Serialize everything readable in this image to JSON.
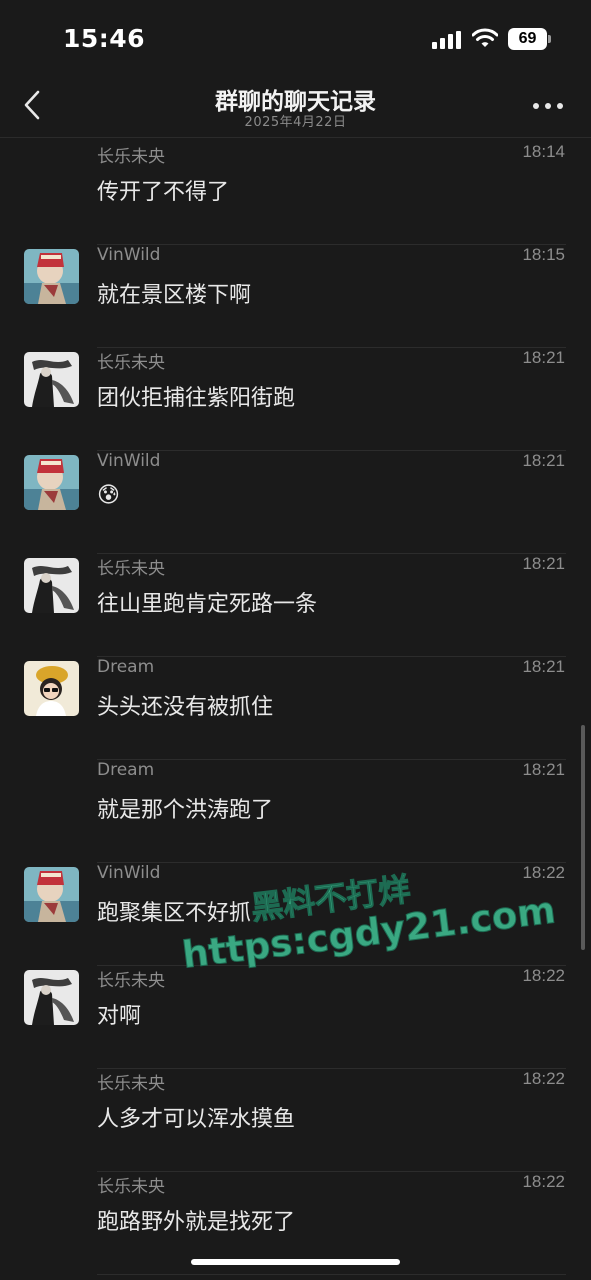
{
  "status_bar": {
    "time": "15:46",
    "battery": "69"
  },
  "header": {
    "title": "群聊的聊天记录",
    "subtitle": "2025年4月22日"
  },
  "messages": [
    {
      "sender": "长乐未央",
      "time": "18:14",
      "text": "传开了不得了",
      "avatar": "none"
    },
    {
      "sender": "VinWild",
      "time": "18:15",
      "text": "就在景区楼下啊",
      "avatar": "vinwild"
    },
    {
      "sender": "长乐未央",
      "time": "18:21",
      "text": "团伙拒捕往紫阳街跑",
      "avatar": "changle"
    },
    {
      "sender": "VinWild",
      "time": "18:21",
      "text": "😰",
      "avatar": "vinwild"
    },
    {
      "sender": "长乐未央",
      "time": "18:21",
      "text": "往山里跑肯定死路一条",
      "avatar": "changle"
    },
    {
      "sender": "Dream",
      "time": "18:21",
      "text": "头头还没有被抓住",
      "avatar": "dream"
    },
    {
      "sender": "Dream",
      "time": "18:21",
      "text": "就是那个洪涛跑了",
      "avatar": "none"
    },
    {
      "sender": "VinWild",
      "time": "18:22",
      "text": "跑聚集区不好抓",
      "avatar": "vinwild"
    },
    {
      "sender": "长乐未央",
      "time": "18:22",
      "text": "对啊",
      "avatar": "changle"
    },
    {
      "sender": "长乐未央",
      "time": "18:22",
      "text": "人多才可以浑水摸鱼",
      "avatar": "none"
    },
    {
      "sender": "长乐未央",
      "time": "18:22",
      "text": "跑路野外就是找死了",
      "avatar": "none"
    }
  ],
  "watermark": {
    "line1": "黑料不打烊",
    "line2": "https:cgdy21.com"
  },
  "icons": {
    "back": "chevron-left-icon",
    "more": "more-dots-icon",
    "signal": "signal-icon",
    "wifi": "wifi-icon"
  },
  "colors": {
    "background": "#1a1a1a",
    "name_gray": "#8d8d8d",
    "watermark_green": "#3aa882"
  }
}
